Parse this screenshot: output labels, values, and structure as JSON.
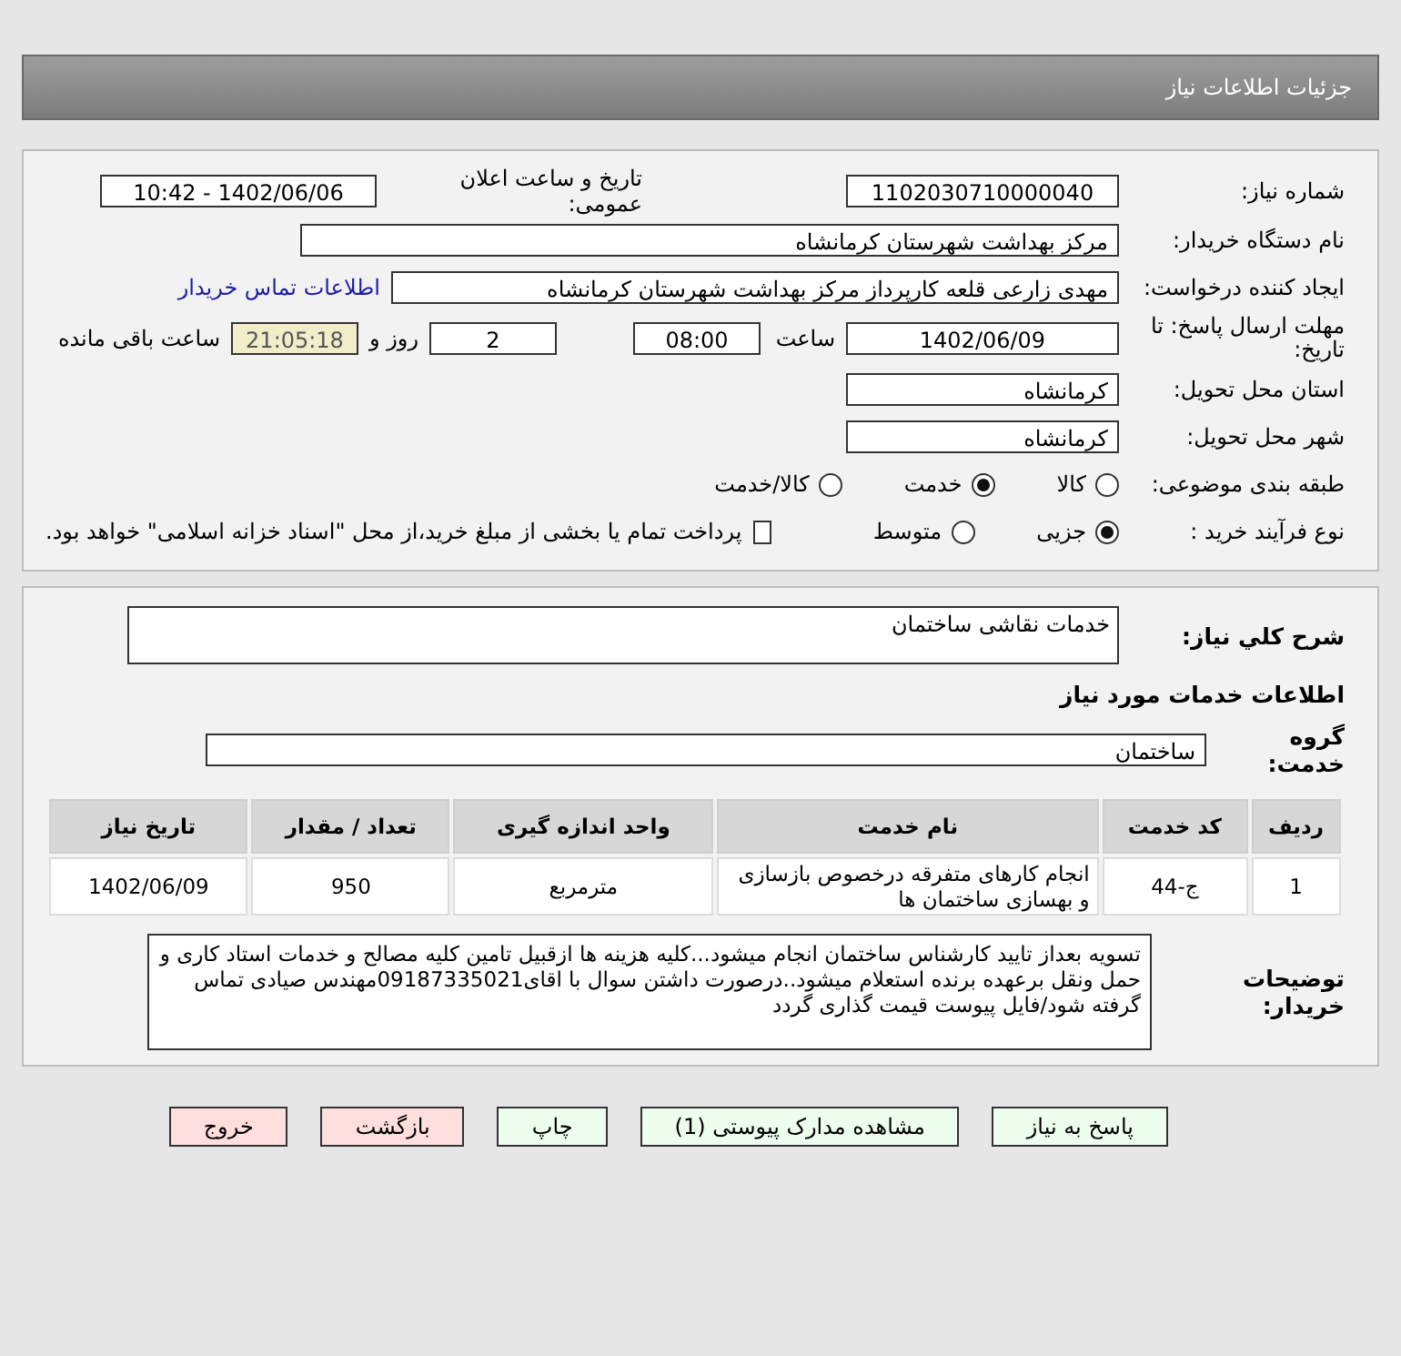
{
  "page_title": "جزئیات اطلاعات نیاز",
  "details": {
    "need_number": {
      "label": "شماره نیاز:",
      "value": "1102030710000040"
    },
    "announce": {
      "label": "تاریخ و ساعت اعلان عمومی:",
      "value": "1402/06/06 - 10:42"
    },
    "buyer_org": {
      "label": "نام دستگاه خریدار:",
      "value": "مرکز بهداشت شهرستان کرمانشاه"
    },
    "creator": {
      "label": "ایجاد کننده درخواست:",
      "value": "مهدی  زارعی قلعه کارپرداز مرکز بهداشت شهرستان کرمانشاه",
      "link": "اطلاعات تماس خریدار"
    },
    "deadline": {
      "label": "مهلت ارسال پاسخ: تا تاریخ:",
      "date": "1402/06/09",
      "time_label": "ساعت",
      "time": "08:00",
      "days": "2",
      "days_label": "روز و",
      "remaining": "21:05:18",
      "remaining_label": "ساعت باقی مانده"
    },
    "province": {
      "label": "استان محل تحویل:",
      "value": "کرمانشاه"
    },
    "city": {
      "label": "شهر محل تحویل:",
      "value": "کرمانشاه"
    },
    "category": {
      "label": "طبقه بندی موضوعی:",
      "options": [
        {
          "label": "کالا",
          "selected": false
        },
        {
          "label": "خدمت",
          "selected": true
        },
        {
          "label": "کالا/خدمت",
          "selected": false
        }
      ]
    },
    "process": {
      "label": "نوع فرآیند خرید :",
      "options": [
        {
          "label": "جزیی",
          "selected": true
        },
        {
          "label": "متوسط",
          "selected": false
        }
      ],
      "payment": {
        "label": "پرداخت تمام یا بخشی از مبلغ خرید،از محل \"اسناد خزانه اسلامی\" خواهد بود.",
        "checked": false
      }
    }
  },
  "services": {
    "summary": {
      "label": "شرح کلي نياز:",
      "value": "خدمات نقاشی ساختمان"
    },
    "heading": "اطلاعات خدمات مورد نیاز",
    "group": {
      "label": "گروه خدمت:",
      "value": "ساختمان"
    },
    "table": {
      "columns": [
        "ردیف",
        "کد خدمت",
        "نام خدمت",
        "واحد اندازه گیری",
        "تعداد / مقدار",
        "تاریخ نیاز"
      ],
      "rows": [
        [
          "1",
          "ج-44",
          "انجام کارهای متفرقه درخصوص بازسازی و بهسازی ساختمان ها",
          "مترمربع",
          "950",
          "1402/06/09"
        ]
      ]
    },
    "notes": {
      "label": "توضیحات خریدار:",
      "value": "تسویه بعداز تایید کارشناس ساختمان انجام میشود...کلیه هزینه ها ازقبیل تامین کلیه مصالح و خدمات استاد کاری و حمل ونقل برعهده برنده استعلام میشود..درصورت داشتن سوال با اقای09187335021مهندس صیادی تماس گرفته شود/فایل پیوست قیمت گذاری گردد"
    }
  },
  "buttons": [
    {
      "label": "پاسخ به نیاز",
      "kind": "primary"
    },
    {
      "label": "مشاهده مدارک پیوستی (1)",
      "kind": "primary"
    },
    {
      "label": "چاپ",
      "kind": "primary"
    },
    {
      "label": "بازگشت",
      "kind": "danger"
    },
    {
      "label": "خروج",
      "kind": "danger"
    }
  ]
}
